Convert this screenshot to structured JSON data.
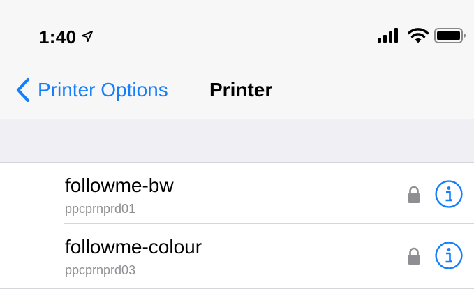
{
  "status_bar": {
    "time": "1:40",
    "location_icon": "location-arrow-icon",
    "signal_icon": "cellular-signal-icon",
    "wifi_icon": "wifi-icon",
    "battery_icon": "battery-icon"
  },
  "nav": {
    "back_label": "Printer Options",
    "back_icon": "chevron-left-icon",
    "title": "Printer"
  },
  "printers": [
    {
      "name": "followme-bw",
      "host": "ppcprnprd01",
      "lock_icon": "lock-icon",
      "info_icon": "info-icon"
    },
    {
      "name": "followme-colour",
      "host": "ppcprnprd03",
      "lock_icon": "lock-icon",
      "info_icon": "info-icon"
    }
  ],
  "colors": {
    "accent": "#147efb",
    "secondary_text": "#8e8e93",
    "bar_background": "#f7f7f7",
    "group_background": "#efeff4",
    "lock": "#8e8e93"
  }
}
